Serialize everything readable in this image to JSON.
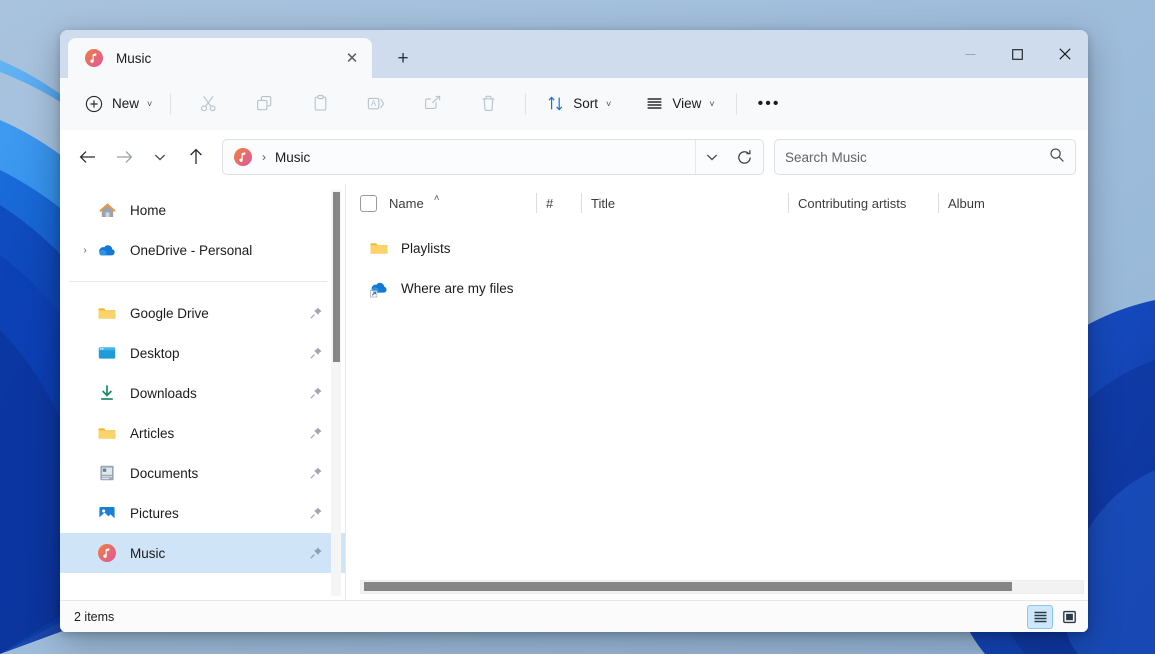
{
  "window": {
    "tab_title": "Music",
    "tab_icon": "music-circle-icon",
    "close_label": "✕",
    "newtab_label": "+",
    "minimize_label": "minimize",
    "maximize_label": "maximize",
    "close_window_label": "close"
  },
  "toolbar": {
    "new_label": "New",
    "new_chevron": "˅",
    "cut_label": "Cut",
    "copy_label": "Copy",
    "paste_label": "Paste",
    "rename_label": "Rename",
    "share_label": "Share",
    "delete_label": "Delete",
    "sort_label": "Sort",
    "sort_chevron": "˅",
    "view_label": "View",
    "view_chevron": "˅",
    "more_label": "•••"
  },
  "navbar": {
    "back_label": "←",
    "forward_label": "→",
    "recent_label": "˅",
    "up_label": "↑",
    "address_icon": "music-circle-icon",
    "breadcrumb_separator": "›",
    "breadcrumb": "Music",
    "address_chevron": "˅",
    "refresh_label": "Refresh",
    "search_placeholder": "Search Music",
    "search_value": "",
    "search_icon": "search-icon"
  },
  "sidebar": {
    "items": [
      {
        "label": "Home",
        "icon": "home-icon",
        "expander": "",
        "pinned": false,
        "selected": false
      },
      {
        "label": "OneDrive - Personal",
        "icon": "onedrive-cloud-icon",
        "expander": "›",
        "pinned": false,
        "selected": false
      },
      {
        "label": "Google Drive",
        "icon": "folder-icon",
        "expander": "",
        "pinned": true,
        "selected": false
      },
      {
        "label": "Desktop",
        "icon": "desktop-icon",
        "expander": "",
        "pinned": true,
        "selected": false
      },
      {
        "label": "Downloads",
        "icon": "downloads-icon",
        "expander": "",
        "pinned": true,
        "selected": false
      },
      {
        "label": "Articles",
        "icon": "folder-icon",
        "expander": "",
        "pinned": true,
        "selected": false
      },
      {
        "label": "Documents",
        "icon": "documents-icon",
        "expander": "",
        "pinned": true,
        "selected": false
      },
      {
        "label": "Pictures",
        "icon": "pictures-icon",
        "expander": "",
        "pinned": true,
        "selected": false
      },
      {
        "label": "Music",
        "icon": "music-circle-icon",
        "expander": "",
        "pinned": true,
        "selected": true
      }
    ],
    "divider_after_index": 1
  },
  "filelist": {
    "columns": [
      {
        "label": "Name",
        "sort": "asc",
        "sort_caret": "˄"
      },
      {
        "label": "#",
        "sort": ""
      },
      {
        "label": "Title",
        "sort": ""
      },
      {
        "label": "Contributing artists",
        "sort": ""
      },
      {
        "label": "Album",
        "sort": ""
      }
    ],
    "rows": [
      {
        "name": "Playlists",
        "icon": "folder-icon"
      },
      {
        "name": "Where are my files",
        "icon": "onedrive-shortcut-icon"
      }
    ]
  },
  "statusbar": {
    "item_count": "2 items",
    "details_view_label": "Details view",
    "icons_view_label": "Large icons view"
  },
  "colors": {
    "titlebar": "#cfdced",
    "toolbar": "#f7f9fb",
    "selection": "#cfe4f7",
    "accent": "#0f6cbd",
    "folder_yellow": "#f5c653",
    "onedrive_blue": "#0f78d4",
    "text": "#1b1b1b"
  }
}
